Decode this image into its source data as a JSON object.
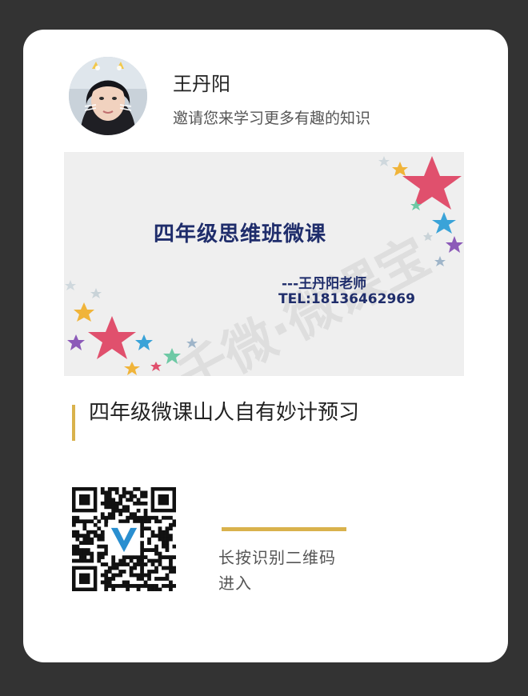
{
  "author": {
    "name": "王丹阳",
    "invite_text": "邀请您来学习更多有趣的知识"
  },
  "cover": {
    "title": "四年级思维班微课",
    "teacher": "---王丹阳老师",
    "tel": "TEL:18136462969",
    "watermark": "千微·微课宝"
  },
  "course": {
    "title": "四年级微课山人自有妙计预习"
  },
  "qr": {
    "hint_line1": "长按识别二维码",
    "hint_line2": "进入"
  },
  "colors": {
    "background": "#333333",
    "card": "#ffffff",
    "accent_gold": "#d9b24c",
    "cover_text": "#1f2d6b"
  }
}
